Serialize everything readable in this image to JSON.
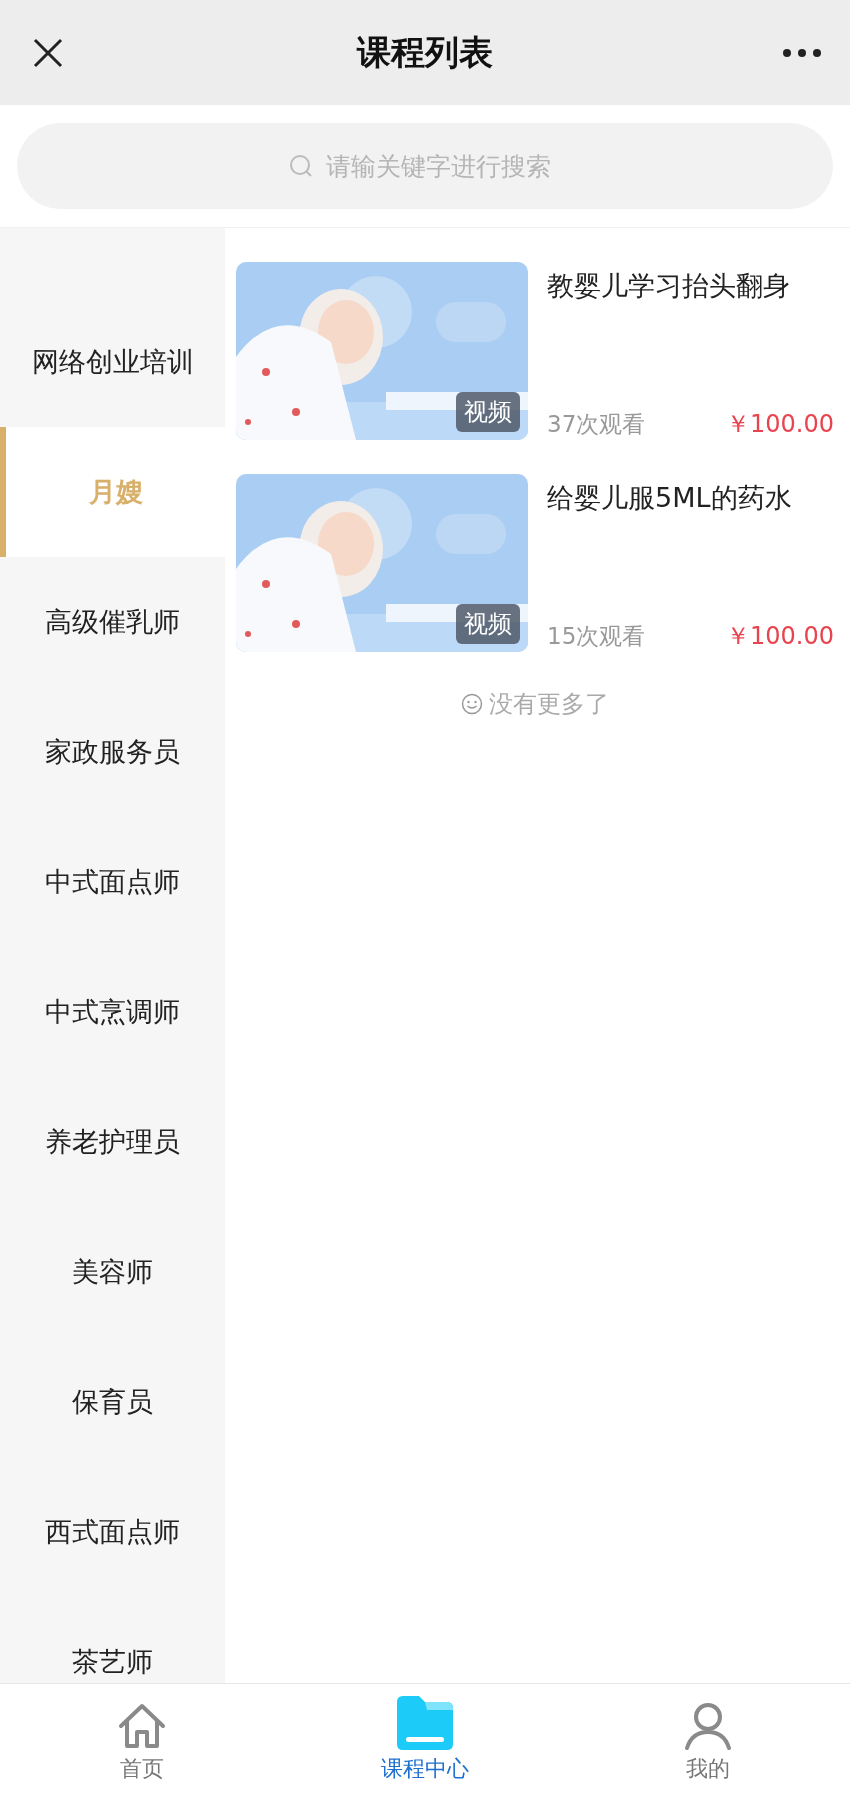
{
  "header": {
    "title": "课程列表"
  },
  "search": {
    "placeholder": "请输关键字进行搜索"
  },
  "categories": [
    {
      "label": "网络创业培训",
      "selected": false
    },
    {
      "label": "月嫂",
      "selected": true
    },
    {
      "label": "高级催乳师",
      "selected": false
    },
    {
      "label": "家政服务员",
      "selected": false
    },
    {
      "label": "中式面点师",
      "selected": false
    },
    {
      "label": "中式烹调师",
      "selected": false
    },
    {
      "label": "养老护理员",
      "selected": false
    },
    {
      "label": "美容师",
      "selected": false
    },
    {
      "label": "保育员",
      "selected": false
    },
    {
      "label": "西式面点师",
      "selected": false
    },
    {
      "label": "茶艺师",
      "selected": false
    }
  ],
  "courses": [
    {
      "title": "教婴儿学习抬头翻身",
      "badge": "视频",
      "views": "37次观看",
      "price": "￥100.00"
    },
    {
      "title": "给婴儿服5ML的药水",
      "badge": "视频",
      "views": "15次观看",
      "price": "￥100.00"
    }
  ],
  "end_note": "没有更多了",
  "tabbar": [
    {
      "label": "首页",
      "kind": "home",
      "selected": false
    },
    {
      "label": "课程中心",
      "kind": "folder",
      "selected": true
    },
    {
      "label": "我的",
      "kind": "person",
      "selected": false
    }
  ]
}
